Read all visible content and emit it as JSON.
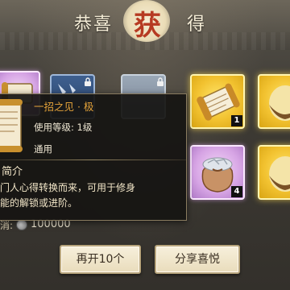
{
  "header": {
    "title_left": "恭喜",
    "title_seal": "获",
    "title_right": "得"
  },
  "rewards": [
    {
      "name": "scroll",
      "quality": "purple",
      "count": null
    },
    {
      "name": "blue-item",
      "quality": "blue",
      "count": null
    },
    {
      "name": "grey-item",
      "quality": "grey",
      "count": null
    },
    {
      "name": "scroll",
      "quality": "gold",
      "count": "1"
    },
    {
      "name": "egg",
      "quality": "gold",
      "count": null
    },
    {
      "name": "silver-bag",
      "quality": "purple",
      "count": "4"
    },
    {
      "name": "egg",
      "quality": "gold",
      "count": null
    }
  ],
  "tooltip": {
    "item_name": "一招之见 · 极",
    "level_requirement": "使用等级: 1级",
    "item_type": "通用",
    "intro_heading": "简介",
    "intro_line1": "门人心得转换而来，可用于修身",
    "intro_line2": "能的解锁或进阶。"
  },
  "cost": {
    "label": "消:",
    "value": "100000"
  },
  "buttons": {
    "again_label": "再开10个",
    "share_label": "分享喜悦"
  },
  "colors": {
    "accent_gold": "#f2c230",
    "accent_purple": "#d6a4e4",
    "item_name": "#e3a23a",
    "seal_red": "#b63a22"
  }
}
